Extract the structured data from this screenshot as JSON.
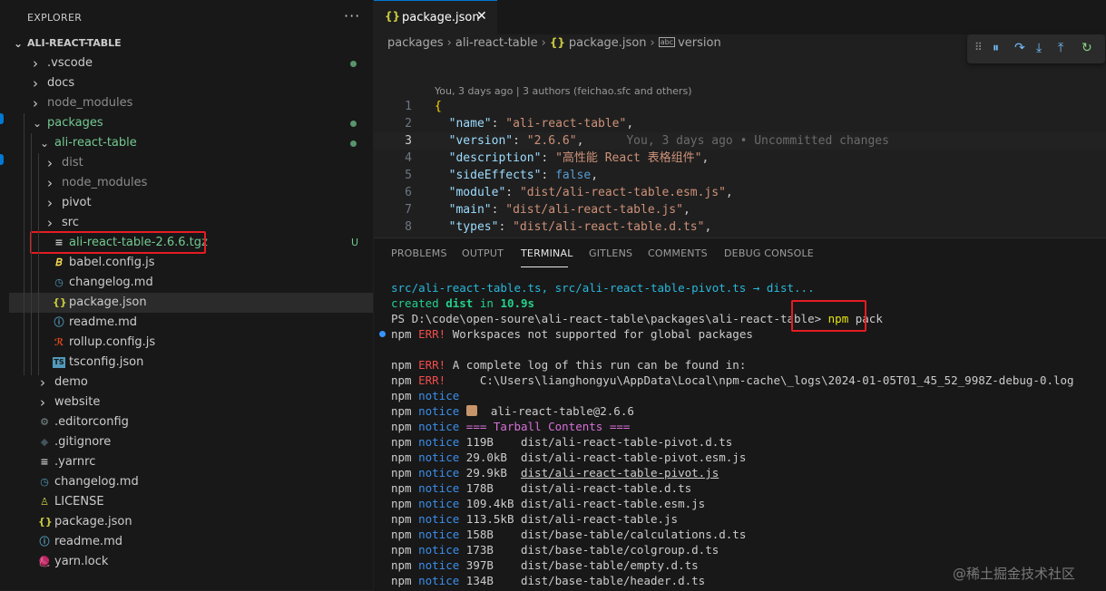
{
  "explorer": {
    "header": "EXPLORER",
    "more": "···",
    "root": "ALI-REACT-TABLE",
    "items": [
      {
        "label": ".vscode",
        "kind": "folder",
        "expanded": false,
        "depth": 1,
        "dot": true
      },
      {
        "label": "docs",
        "kind": "folder",
        "expanded": false,
        "depth": 1
      },
      {
        "label": "node_modules",
        "kind": "folder",
        "expanded": false,
        "depth": 1,
        "dim": true
      },
      {
        "label": "packages",
        "kind": "folder",
        "expanded": true,
        "depth": 1,
        "dot": true,
        "color": "#73c991"
      },
      {
        "label": "ali-react-table",
        "kind": "folder",
        "expanded": true,
        "depth": 2,
        "dot": true,
        "color": "#73c991"
      },
      {
        "label": "dist",
        "kind": "folder",
        "expanded": false,
        "depth": 3,
        "dim": true
      },
      {
        "label": "node_modules",
        "kind": "folder",
        "expanded": false,
        "depth": 3,
        "dim": true
      },
      {
        "label": "pivot",
        "kind": "folder",
        "expanded": false,
        "depth": 3
      },
      {
        "label": "src",
        "kind": "folder",
        "expanded": false,
        "depth": 3
      },
      {
        "label": "ali-react-table-2.6.6.tgz",
        "kind": "file",
        "icon": "≡",
        "iconColor": "#cccccc",
        "depth": 3,
        "badge": "U",
        "color": "#73c991"
      },
      {
        "label": "babel.config.js",
        "kind": "file",
        "icon": "𝐵",
        "iconColor": "#f5da55",
        "depth": 3
      },
      {
        "label": "changelog.md",
        "kind": "file",
        "icon": "◷",
        "iconColor": "#519aba",
        "depth": 3
      },
      {
        "label": "package.json",
        "kind": "file",
        "icon": "{}",
        "iconColor": "#cbcb41",
        "depth": 3,
        "selected": true
      },
      {
        "label": "readme.md",
        "kind": "file",
        "icon": "ⓘ",
        "iconColor": "#519aba",
        "depth": 3
      },
      {
        "label": "rollup.config.js",
        "kind": "file",
        "icon": "ℛ",
        "iconColor": "#e64a19",
        "depth": 3
      },
      {
        "label": "tsconfig.json",
        "kind": "file",
        "icon": "TS",
        "iconColor": "#519aba",
        "depth": 3
      },
      {
        "label": "demo",
        "kind": "folder",
        "expanded": false,
        "depth": 2
      },
      {
        "label": "website",
        "kind": "folder",
        "expanded": false,
        "depth": 2
      },
      {
        "label": ".editorconfig",
        "kind": "file",
        "icon": "⚙",
        "iconColor": "#7f8c8d",
        "depth": 1
      },
      {
        "label": ".gitignore",
        "kind": "file",
        "icon": "◆",
        "iconColor": "#41535b",
        "depth": 1
      },
      {
        "label": ".yarnrc",
        "kind": "file",
        "icon": "≡",
        "iconColor": "#cccccc",
        "depth": 1
      },
      {
        "label": "changelog.md",
        "kind": "file",
        "icon": "◷",
        "iconColor": "#519aba",
        "depth": 1
      },
      {
        "label": "LICENSE",
        "kind": "file",
        "icon": "♙",
        "iconColor": "#cbcb41",
        "depth": 1
      },
      {
        "label": "package.json",
        "kind": "file",
        "icon": "{}",
        "iconColor": "#cbcb41",
        "depth": 1
      },
      {
        "label": "readme.md",
        "kind": "file",
        "icon": "ⓘ",
        "iconColor": "#519aba",
        "depth": 1
      },
      {
        "label": "yarn.lock",
        "kind": "file",
        "icon": "🧶",
        "iconColor": "#2c8ebb",
        "depth": 1
      }
    ]
  },
  "editor": {
    "tab": {
      "icon": "{}",
      "label": "package.json",
      "close": "✕"
    },
    "breadcrumb": [
      "packages",
      "ali-react-table",
      "package.json",
      "version"
    ],
    "blame": "You, 3 days ago | 3 authors (feichao.sfc and others)",
    "current_line": 3,
    "lines": [
      {
        "n": "1",
        "html": "<span class='br'>{</span>"
      },
      {
        "n": "2",
        "html": "  <span class='k'>\"name\"</span><span class='p'>: </span><span class='s'>\"ali-react-table\"</span><span class='p'>,</span>"
      },
      {
        "n": "3",
        "html": "  <span class='k'>\"version\"</span><span class='p'>: </span><span class='s'>\"2.6.6\"</span><span class='p'>,</span>",
        "ghost": "      You, 3 days ago • Uncommitted changes"
      },
      {
        "n": "4",
        "html": "  <span class='k'>\"description\"</span><span class='p'>: </span><span class='s'>\"高性能 React 表格组件\"</span><span class='p'>,</span>"
      },
      {
        "n": "5",
        "html": "  <span class='k'>\"sideEffects\"</span><span class='p'>: </span><span class='b'>false</span><span class='p'>,</span>"
      },
      {
        "n": "6",
        "html": "  <span class='k'>\"module\"</span><span class='p'>: </span><span class='s'>\"dist/ali-react-table.esm.js\"</span><span class='p'>,</span>"
      },
      {
        "n": "7",
        "html": "  <span class='k'>\"main\"</span><span class='p'>: </span><span class='s'>\"dist/ali-react-table.js\"</span><span class='p'>,</span>"
      },
      {
        "n": "8",
        "html": "  <span class='k'>\"types\"</span><span class='p'>: </span><span class='s'>\"dist/ali-react-table.d.ts\"</span><span class='p'>,</span>"
      }
    ]
  },
  "panel": {
    "tabs": [
      "PROBLEMS",
      "OUTPUT",
      "TERMINAL",
      "GITLENS",
      "COMMENTS",
      "DEBUG CONSOLE"
    ],
    "active_tab": "TERMINAL",
    "terminal": [
      {
        "html": "<span class='cyan'>src/ali-react-table.ts, src/ali-react-table-pivot.ts → dist...</span>"
      },
      {
        "html": "<span class='green'>created <b>dist</b> in <b>10.9s</b></span>"
      },
      {
        "html": "PS D:\\code\\open-soure\\ali-react-table\\packages\\ali-react-table&gt; <span class='yellow'>npm</span> pack"
      },
      {
        "html": "npm <span class='err'>ERR!</span> Workspaces not supported for global packages"
      },
      {
        "html": ""
      },
      {
        "html": "npm <span class='err'>ERR!</span> A complete log of this run can be found in:"
      },
      {
        "html": "npm <span class='err'>ERR!</span>     C:\\Users\\lianghongyu\\AppData\\Local\\npm-cache\\_logs\\2024-01-05T01_45_52_998Z-debug-0.log"
      },
      {
        "html": "npm <span class='notice'>notice</span>"
      },
      {
        "html": "npm <span class='notice'>notice</span> <span class='pkg-emoji'></span>  ali-react-table@2.6.6"
      },
      {
        "html": "npm <span class='notice'>notice</span> <span class='magenta'>=== Tarball Contents ===</span>"
      },
      {
        "html": "npm <span class='notice'>notice</span> 119B    dist/ali-react-table-pivot.d.ts"
      },
      {
        "html": "npm <span class='notice'>notice</span> 29.0kB  dist/ali-react-table-pivot.esm.js"
      },
      {
        "html": "npm <span class='notice'>notice</span> 29.9kB  <span class='ul'>dist/ali-react-table-pivot.js</span>"
      },
      {
        "html": "npm <span class='notice'>notice</span> 178B    dist/ali-react-table.d.ts"
      },
      {
        "html": "npm <span class='notice'>notice</span> 109.4kB dist/ali-react-table.esm.js"
      },
      {
        "html": "npm <span class='notice'>notice</span> 113.5kB dist/ali-react-table.js"
      },
      {
        "html": "npm <span class='notice'>notice</span> 158B    dist/base-table/calculations.d.ts"
      },
      {
        "html": "npm <span class='notice'>notice</span> 173B    dist/base-table/colgroup.d.ts"
      },
      {
        "html": "npm <span class='notice'>notice</span> 397B    dist/base-table/empty.d.ts"
      },
      {
        "html": "npm <span class='notice'>notice</span> 134B    dist/base-table/header.d.ts"
      }
    ]
  },
  "watermark": "@稀土掘金技术社区",
  "colors": {
    "accent": "#0078d4",
    "highlight": "#e51c23",
    "git_added": "#73c991"
  }
}
